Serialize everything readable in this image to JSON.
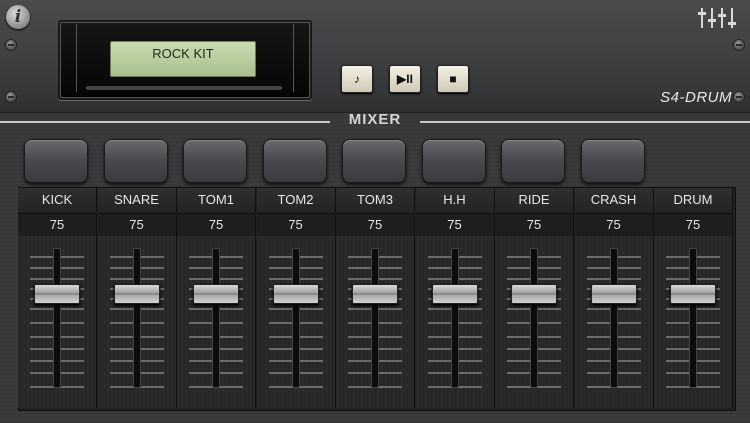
{
  "display": {
    "kit_name": "ROCK KIT"
  },
  "transport": {
    "note_label": "♪",
    "play_pause_label": "▶II",
    "stop_label": "■"
  },
  "brand": {
    "name": "S4-DRUM"
  },
  "mixer": {
    "title": "MIXER",
    "channels": [
      {
        "name": "KICK",
        "value": "75",
        "level": 75
      },
      {
        "name": "SNARE",
        "value": "75",
        "level": 75
      },
      {
        "name": "TOM1",
        "value": "75",
        "level": 75
      },
      {
        "name": "TOM2",
        "value": "75",
        "level": 75
      },
      {
        "name": "TOM3",
        "value": "75",
        "level": 75
      },
      {
        "name": "H.H",
        "value": "75",
        "level": 75
      },
      {
        "name": "RIDE",
        "value": "75",
        "level": 75
      },
      {
        "name": "CRASH",
        "value": "75",
        "level": 75
      },
      {
        "name": "DRUM",
        "value": "75",
        "level": 75
      }
    ]
  },
  "icons": {
    "info": "info-icon",
    "settings": "faders-icon"
  }
}
